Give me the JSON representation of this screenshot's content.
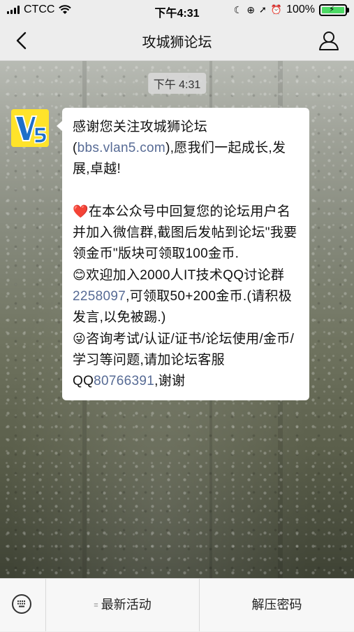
{
  "status_bar": {
    "carrier": "CTCC",
    "time": "下午4:31",
    "battery": "100%",
    "battery_level": 1.0
  },
  "nav": {
    "title": "攻城狮论坛"
  },
  "chat": {
    "timestamp": "下午 4:31",
    "message": {
      "intro_1": "感谢您关注攻城狮论坛(",
      "intro_link": "bbs.vlan5.com",
      "intro_2": "),愿我们一起成长,发展,卓越!",
      "heart_emoji": "❤️",
      "para1": "在本公众号中回复您的论坛用户名并加入微信群,截图后发帖到论坛\"我要领金币\"版块可领取100金币.",
      "smile_emoji": "😊",
      "para2a": "欢迎加入2000人IT技术QQ讨论群",
      "qq_group": "2258097",
      "para2b": ",可领取50+200金币.(请积极发言,以免被踢.)",
      "wink_emoji": "😜",
      "para3a": "咨询考试/认证/证书/论坛使用/金币/学习等问题,请加论坛客服QQ",
      "qq_service": "80766391",
      "para3b": ",谢谢"
    }
  },
  "bottom_menu": {
    "item1": "最新活动",
    "item2": "解压密码"
  },
  "colors": {
    "link": "#576b95",
    "avatar_bg": "#ffe32a",
    "battery_green": "#4cd964"
  }
}
